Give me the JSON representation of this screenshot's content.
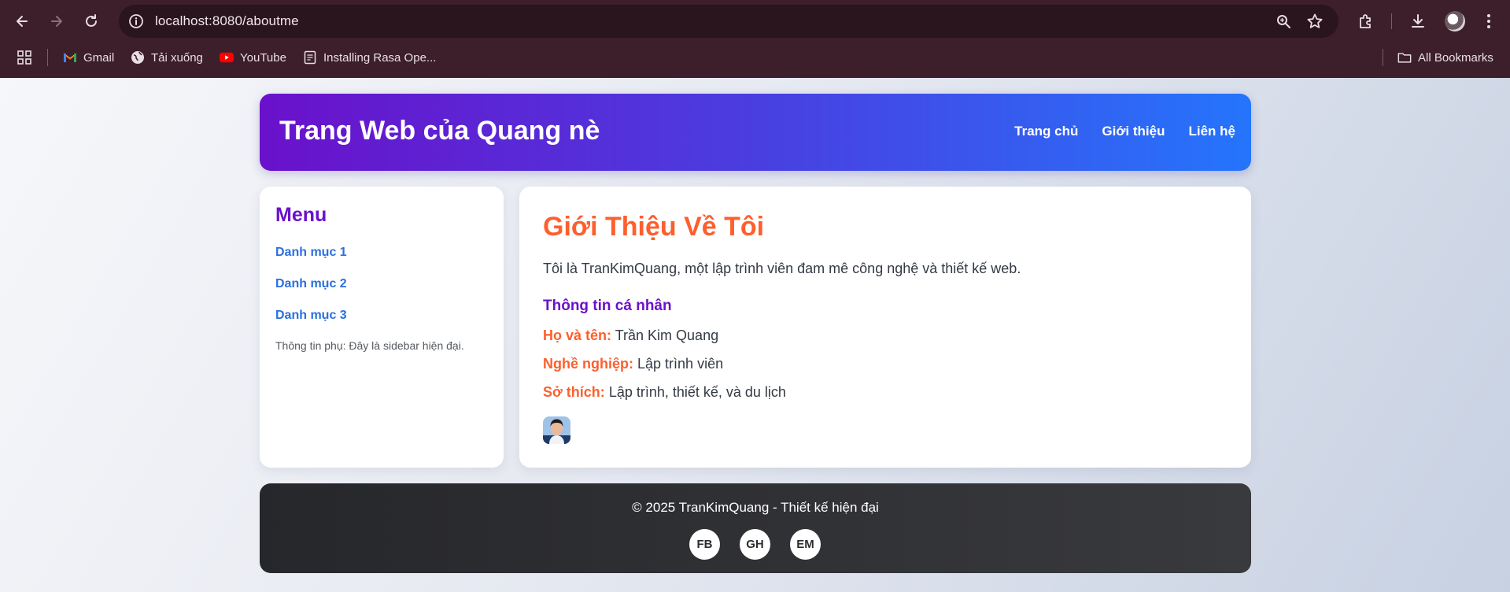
{
  "browser": {
    "url": "localhost:8080/aboutme",
    "bookmarks": [
      {
        "label": "Gmail",
        "icon": "gmail-icon"
      },
      {
        "label": "Tải xuống",
        "icon": "globe-icon"
      },
      {
        "label": "YouTube",
        "icon": "youtube-icon"
      },
      {
        "label": "Installing Rasa Ope...",
        "icon": "page-icon"
      }
    ],
    "all_bookmarks": "All Bookmarks"
  },
  "header": {
    "title": "Trang Web của Quang nè",
    "nav": [
      "Trang chủ",
      "Giới thiệu",
      "Liên hệ"
    ]
  },
  "sidebar": {
    "title": "Menu",
    "links": [
      "Danh mục 1",
      "Danh mục 2",
      "Danh mục 3"
    ],
    "note": "Thông tin phụ: Đây là sidebar hiện đại."
  },
  "main": {
    "title": "Giới Thiệu Về Tôi",
    "intro": "Tôi là TranKimQuang, một lập trình viên đam mê công nghệ và thiết kế web.",
    "section_heading": "Thông tin cá nhân",
    "fields": [
      {
        "label": "Họ và tên:",
        "value": "Trần Kim Quang"
      },
      {
        "label": "Nghề nghiệp:",
        "value": "Lập trình viên"
      },
      {
        "label": "Sở thích:",
        "value": "Lập trình, thiết kế, và du lịch"
      }
    ]
  },
  "footer": {
    "copyright": "© 2025 TranKimQuang - Thiết kế hiện đại",
    "social": [
      "FB",
      "GH",
      "EM"
    ]
  },
  "colors": {
    "header_gradient_start": "#6a11cb",
    "header_gradient_end": "#2575fc",
    "accent_orange": "#fd5f2d",
    "link_blue": "#2a6fe0",
    "footer_bg": "#2e2f33",
    "chrome_bg": "#3c1f2a"
  }
}
